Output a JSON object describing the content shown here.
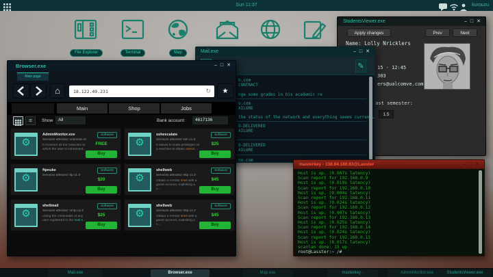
{
  "chrome": {
    "min": "–",
    "max": "□",
    "close": "✕"
  },
  "icons_glyphs": {
    "home": "⌂",
    "refresh": "↻",
    "star": "★",
    "pencil": "✎",
    "envelope": "✉",
    "gear": "⚙",
    "list_view": "≡"
  },
  "topbar": {
    "time": "Sun 11:37",
    "user": "kurouzu"
  },
  "desktop_icons": [
    {
      "label": "File Explorer"
    },
    {
      "label": "Terminal"
    },
    {
      "label": "Map"
    },
    {
      "label": "Mail"
    },
    {
      "label": "Browser"
    },
    {
      "label": "Notepad"
    }
  ],
  "students": {
    "title": "StudentsViewer.exe",
    "apply_button": "Apply changes",
    "prev_button": "Prev",
    "next_button": "Next",
    "name_line": "Name: Lolly Nricklers",
    "schedule_fragment": "15 - 12:45",
    "room_fragment": "303",
    "email_fragment": "ers@ualcomve.com",
    "last_semester_label": "Last semester:",
    "last_semester_value": "1.5"
  },
  "mail": {
    "title": "Mail.exe",
    "rows": [
      {
        "line1": "b.com",
        "line2": "CONTRACT",
        "line3": "nge some grades in his academic re"
      },
      {
        "line1": "o.com",
        "line2": "AILURE",
        "line3": "the status of the network and everything seems current…"
      },
      {
        "line1": "O-DELIVERED",
        "line2": "AILURE"
      },
      {
        "line1": "O-DELIVERED",
        "line2": "AILURE"
      },
      {
        "line1": "no.com"
      }
    ]
  },
  "browser": {
    "title": "Browser.exe",
    "tab": "Main page",
    "url": "18.122.49.231",
    "site_tabs": [
      "Main",
      "Shop",
      "Jobs"
    ],
    "show_label": "Show",
    "show_value": "All",
    "bank_label": "Bank account:",
    "bank_value": "4617136",
    "cards": [
      {
        "title": "AdminMonitor.exe",
        "services": "Services affected: unknown v0",
        "badge": "Software",
        "price": "FREE",
        "buy": "Buy",
        "d1": "It monitors all the networks to which the user is connected…",
        "d2": "",
        "d3": ""
      },
      {
        "title": "sshescalate",
        "services": "Services affected: ssh v1.0",
        "badge": "Software",
        "price": "$25",
        "buy": "Buy",
        "d1": "It allows to scale privileges on a machine to obtain ",
        "d2": "admin",
        "d3": "…"
      },
      {
        "title": "ftpnuke",
        "services": "Services affected: ftp v1.0",
        "badge": "Software",
        "price": "$20",
        "buy": "Buy",
        "d1": "",
        "d2": "",
        "d3": ""
      },
      {
        "title": "shellweb",
        "services": "Services affected: http v1.0",
        "badge": "Software",
        "price": "$45",
        "buy": "Buy",
        "d1": "Obtain a remote ",
        "d2": "shell",
        "d3": " with a guest account, exploiting a v…"
      },
      {
        "title": "shellmail",
        "services": "Services affected: smtp v1.0",
        "badge": "Software",
        "price": "$25",
        "buy": "Buy",
        "d1": "Using the credentials of any user registered in the ",
        "d2": "mail s",
        "d3": "…"
      },
      {
        "title": "shellweb",
        "services": "Services affected: http v1.0",
        "badge": "Software",
        "price": "$45",
        "buy": "Buy",
        "d1": "Obtain a remote ",
        "d2": "shell",
        "d3": " with a guest account, exploiting a v…"
      }
    ]
  },
  "terminal": {
    "title": "masterkey - 138.84.180.83@Lasster",
    "lines": [
      "Host is up. (0.007s latency)",
      "Scan report for 192.168.0.9",
      "Host is up. (0.010s latency)",
      "Scan report for 192.168.0.10",
      "Host is up. (0.004s latency)",
      "Scan report for 192.168.0.11",
      "Host is up. (0.024s latency)",
      "Scan report for 192.168.0.12",
      "Host is up. (0.007s latency)",
      "Scan report for 192.168.0.13",
      "Host is up. (0.025s latency)",
      "Scan report for 192.168.0.14",
      "Host is up. (0.024s latency)",
      "Scan report for 192.168.0.15",
      "Host is up. (0.017s latency)",
      "scanlan done: 15 up",
      "root@Lasster:~ /#"
    ]
  },
  "taskbar": {
    "items": [
      {
        "label": "Mail.exe"
      },
      {
        "label": "Browser.exe"
      },
      {
        "label": "Map.exe"
      },
      {
        "label": "masterkey -"
      },
      {
        "label": "AdminMonitor.exe"
      },
      {
        "label": "StudentsViewer.exe"
      }
    ]
  }
}
